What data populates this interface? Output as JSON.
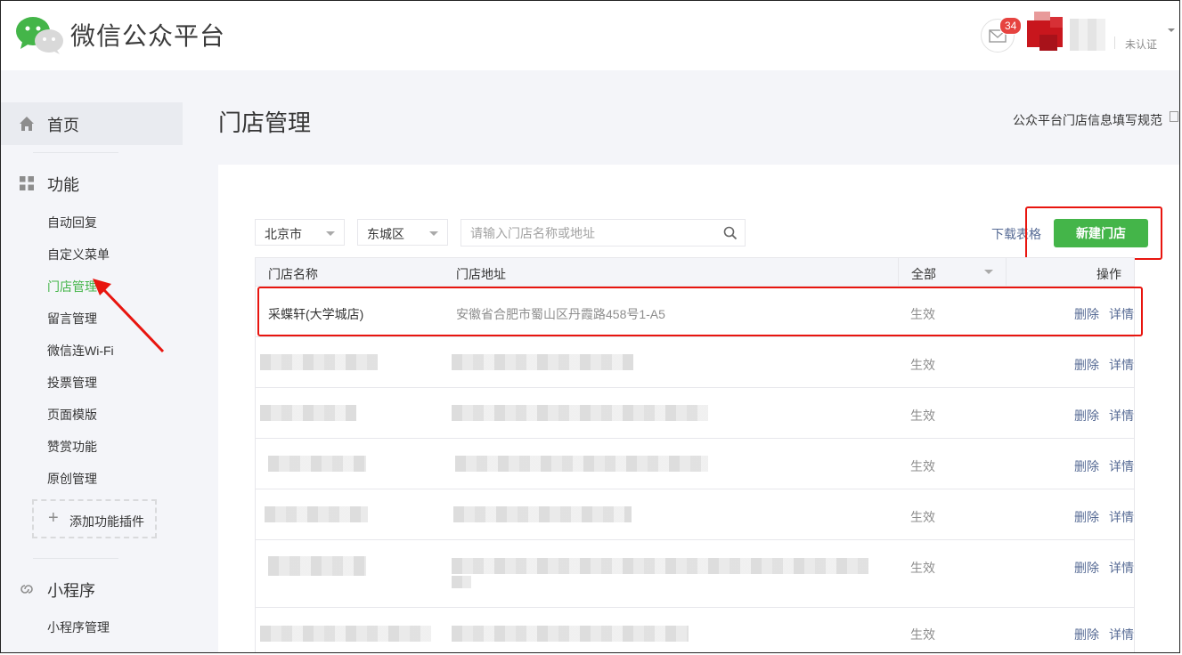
{
  "header": {
    "logo_text": "微信公众平台",
    "mail_badge": "34",
    "verify_label": "未认证"
  },
  "sidebar": {
    "home_label": "首页",
    "function_label": "功能",
    "function_items": [
      {
        "label": "自动回复"
      },
      {
        "label": "自定义菜单"
      },
      {
        "label": "门店管理",
        "active": true
      },
      {
        "label": "留言管理"
      },
      {
        "label": "微信连Wi-Fi"
      },
      {
        "label": "投票管理"
      },
      {
        "label": "页面模版"
      },
      {
        "label": "赞赏功能"
      },
      {
        "label": "原创管理"
      }
    ],
    "add_plugin_label": "添加功能插件",
    "miniprogram_label": "小程序",
    "miniprogram_items": [
      {
        "label": "小程序管理"
      }
    ]
  },
  "main": {
    "title": "门店管理",
    "help_link": "公众平台门店信息填写规范",
    "filters": {
      "city": "北京市",
      "district": "东城区",
      "search_placeholder": "请输入门店名称或地址"
    },
    "download_label": "下载表格",
    "new_store_button": "新建门店",
    "table": {
      "columns": [
        "门店名称",
        "门店地址",
        "全部",
        "操作"
      ],
      "rows": [
        {
          "name": "采蝶轩(大学城店)",
          "address": "安徽省合肥市蜀山区丹霞路458号1-A5",
          "status": "生效",
          "delete": "删除",
          "detail": "详情"
        },
        {
          "name": "",
          "address": "",
          "status": "生效",
          "delete": "删除",
          "detail": "详情"
        },
        {
          "name": "",
          "address": "",
          "status": "生效",
          "delete": "删除",
          "detail": "详情"
        },
        {
          "name": "",
          "address": "",
          "status": "生效",
          "delete": "删除",
          "detail": "详情"
        },
        {
          "name": "",
          "address": "",
          "status": "生效",
          "delete": "删除",
          "detail": "详情"
        },
        {
          "name": "",
          "address": "",
          "status": "生效",
          "delete": "删除",
          "detail": "详情"
        },
        {
          "name": "",
          "address": "",
          "status": "生效",
          "delete": "删除",
          "detail": "详情"
        }
      ]
    }
  },
  "colors": {
    "brand_green": "#44b549",
    "link_blue": "#576b95",
    "annotation_red": "#e8150f",
    "badge_red": "#e64340"
  },
  "icons": [
    "wechat-logo-icon",
    "mail-icon",
    "home-icon",
    "grid-icon",
    "plus-icon",
    "link-icon",
    "search-icon",
    "document-icon",
    "arrow-annotation"
  ]
}
